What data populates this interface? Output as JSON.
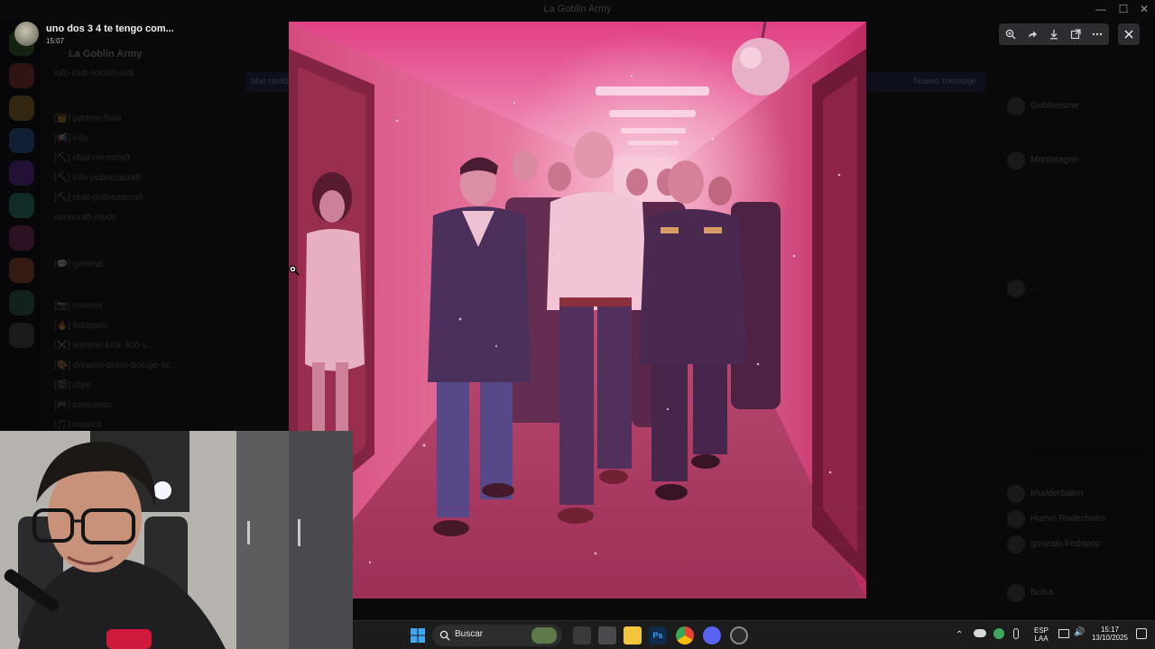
{
  "window": {
    "title": "La Goblin Army"
  },
  "viewer": {
    "message": "uno dos 3 4 te tengo com...",
    "time": "15:07"
  },
  "background": {
    "guild_name": "La Goblin Army",
    "top_channel": "info-club-rocket-sick",
    "channels": [
      "[👑] partner-host",
      "[📢] info",
      "[⛏️] chat-minecraft",
      "[⛏️] info-pobrezacraft",
      "[⛏️] chat-pobrezacraft",
      "minecraft-mods",
      "[💬] general",
      "[📷] memes",
      "[🔥] listopatic",
      "[⚔️] sorteos-kick-300-s...",
      "[🎨] dreamo-pulse-boluge-sc...",
      "[🎬] clips",
      "[🎮] consenso",
      "[🎵] musica"
    ],
    "banner_left": "ahe ravidh",
    "banner_right": "Nuevo mensaje",
    "members": [
      "Goblinesme",
      "Monteragon",
      "...",
      "Mudderbalon",
      "Huevo Rodecheiro",
      "gonzalo.fredapop",
      "Bolsa"
    ]
  },
  "taskbar": {
    "search_placeholder": "Buscar",
    "lang_line1": "ESP",
    "lang_line2": "LAA",
    "clock_time": "15:17",
    "clock_date": "13/10/2025"
  },
  "icons": {
    "zoom": "zoom-in-icon",
    "forward": "forward-icon",
    "download": "download-icon",
    "open": "open-external-icon",
    "more": "more-icon",
    "close": "close-icon"
  },
  "colors": {
    "accent": "#5865f2",
    "photo_tint": "#e0457f",
    "taskbar": "#1c1c1c"
  }
}
